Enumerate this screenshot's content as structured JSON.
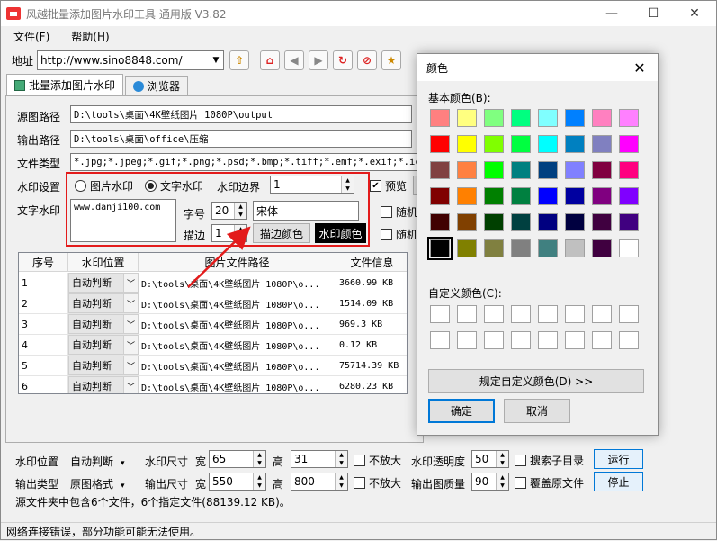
{
  "window": {
    "title": "风越批量添加图片水印工具 通用版 V3.82",
    "min": "—",
    "max": "☐",
    "close": "✕"
  },
  "menu": {
    "file": "文件(F)",
    "help": "帮助(H)"
  },
  "toolbar": {
    "address_label": "地址",
    "address_value": "http://www.sino8848.com/"
  },
  "tabs": [
    {
      "label": "批量添加图片水印"
    },
    {
      "label": "浏览器"
    }
  ],
  "form": {
    "source_label": "源图路径",
    "source_value": "D:\\tools\\桌面\\4K壁纸图片 1080P\\output",
    "output_label": "输出路径",
    "output_value": "D:\\tools\\桌面\\office\\压缩",
    "filetype_label": "文件类型",
    "filetype_value": "*.jpg;*.jpeg;*.gif;*.png;*.psd;*.bmp;*.tiff;*.emf;*.exif;*.ico;*",
    "wm_setting_label": "水印设置",
    "radio_image": "图片水印",
    "radio_text": "文字水印",
    "wm_border_label": "水印边界",
    "wm_border_value": "1",
    "preview_label": "预览",
    "text_wm_label": "文字水印",
    "text_wm_value": "www.danji100.com",
    "font_size_label": "字号",
    "font_size_value": "20",
    "font_name_value": "宋体",
    "stroke_label": "描边",
    "stroke_value": "1",
    "stroke_color_btn": "描边颜色",
    "wm_color_btn": "水印颜色",
    "random1": "随机",
    "random2": "随机"
  },
  "table": {
    "headers": [
      "序号",
      "水印位置",
      "图片文件路径",
      "文件信息"
    ],
    "rows": [
      {
        "no": "1",
        "pos": "自动判断",
        "path": "D:\\tools\\桌面\\4K壁纸图片 1080P\\o...",
        "info": "3660.99 KB"
      },
      {
        "no": "2",
        "pos": "自动判断",
        "path": "D:\\tools\\桌面\\4K壁纸图片 1080P\\o...",
        "info": "1514.09 KB"
      },
      {
        "no": "3",
        "pos": "自动判断",
        "path": "D:\\tools\\桌面\\4K壁纸图片 1080P\\o...",
        "info": "969.3 KB"
      },
      {
        "no": "4",
        "pos": "自动判断",
        "path": "D:\\tools\\桌面\\4K壁纸图片 1080P\\o...",
        "info": "0.12 KB"
      },
      {
        "no": "5",
        "pos": "自动判断",
        "path": "D:\\tools\\桌面\\4K壁纸图片 1080P\\o...",
        "info": "75714.39 KB"
      },
      {
        "no": "6",
        "pos": "自动判断",
        "path": "D:\\tools\\桌面\\4K壁纸图片 1080P\\o...",
        "info": "6280.23 KB"
      }
    ]
  },
  "bottom": {
    "wm_pos_label": "水印位置",
    "wm_pos_value": "自动判断",
    "wm_size_label": "水印尺寸",
    "width_label": "宽",
    "wm_w": "65",
    "height_label": "高",
    "wm_h": "31",
    "no_enlarge1": "不放大",
    "opacity_label": "水印透明度",
    "opacity_value": "50",
    "search_sub": "搜索子目录",
    "run_btn": "运行",
    "out_type_label": "输出类型",
    "out_type_value": "原图格式",
    "out_size_label": "输出尺寸",
    "width_label2": "宽",
    "out_w": "550",
    "height_label2": "高",
    "out_h": "800",
    "no_enlarge2": "不放大",
    "quality_label": "输出图质量",
    "quality_value": "90",
    "overwrite": "覆盖原文件",
    "stop_btn": "停止",
    "summary": "源文件夹中包含6个文件，6个指定文件(88139.12 KB)。"
  },
  "status": "网络连接错误，部分功能可能无法使用。",
  "color_dialog": {
    "title": "颜色",
    "close": "✕",
    "basic_label": "基本颜色(B):",
    "custom_label": "自定义颜色(C):",
    "define_btn": "规定自定义颜色(D) >>",
    "ok_btn": "确定",
    "cancel_btn": "取消",
    "basic_colors": [
      "#ff8080",
      "#ffff80",
      "#80ff80",
      "#00ff80",
      "#80ffff",
      "#0080ff",
      "#ff80c0",
      "#ff80ff",
      "#ff0000",
      "#ffff00",
      "#80ff00",
      "#00ff40",
      "#00ffff",
      "#0080c0",
      "#8080c0",
      "#ff00ff",
      "#804040",
      "#ff8040",
      "#00ff00",
      "#008080",
      "#004080",
      "#8080ff",
      "#800040",
      "#ff0080",
      "#800000",
      "#ff8000",
      "#008000",
      "#008040",
      "#0000ff",
      "#0000a0",
      "#800080",
      "#8000ff",
      "#400000",
      "#804000",
      "#004000",
      "#004040",
      "#000080",
      "#000040",
      "#400040",
      "#400080",
      "#000000",
      "#808000",
      "#808040",
      "#808080",
      "#408080",
      "#c0c0c0",
      "#400040",
      "#ffffff"
    ],
    "selected_index": 40
  }
}
